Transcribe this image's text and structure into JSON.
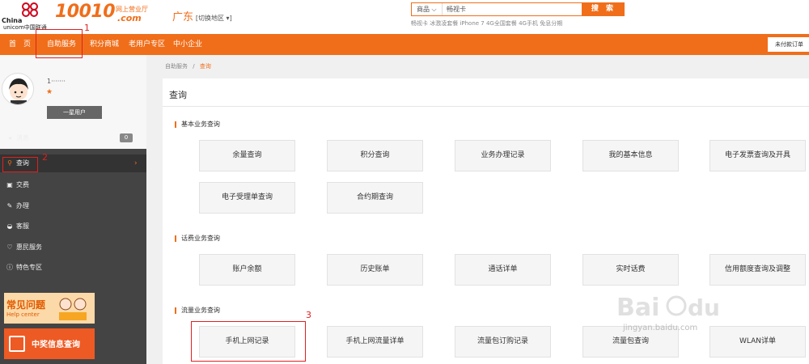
{
  "header": {
    "logo": {
      "en_line1": "China",
      "en_line2": "unicom中国联通"
    },
    "brand": {
      "number": "10010",
      "hall": "网上营业厅",
      "domain": ".com"
    },
    "region": {
      "province": "广东",
      "switch_label": "[切换地区 ▾]"
    },
    "search": {
      "category": "商品 ⌵",
      "value": "畅视卡",
      "button_label": "搜 索",
      "hot_words": "畅视卡  冰激凌套餐  iPhone 7  4G全国套餐  4G手机  免息分期"
    }
  },
  "nav": {
    "items": [
      "首　页",
      "自助服务",
      "积分商城",
      "老用户专区",
      "中小企业"
    ],
    "cart_label": "未付款订单"
  },
  "sidebar": {
    "username": "1·······",
    "star": "★",
    "level": "一星用户",
    "items": [
      {
        "icon": "speaker-icon",
        "glyph": "◂",
        "label": "消息",
        "count": "0"
      },
      {
        "icon": "search-icon",
        "glyph": "⚲",
        "label": "查询"
      },
      {
        "icon": "payment-icon",
        "glyph": "▣",
        "label": "交费"
      },
      {
        "icon": "pen-icon",
        "glyph": "✎",
        "label": "办理"
      },
      {
        "icon": "headset-icon",
        "glyph": "◒",
        "label": "客服"
      },
      {
        "icon": "heart-icon",
        "glyph": "♡",
        "label": "惠民服务"
      },
      {
        "icon": "info-icon",
        "glyph": "ⓘ",
        "label": "特色专区"
      }
    ],
    "banner_faq": {
      "title": "常见问题",
      "subtitle": "Help center"
    },
    "banner_prize": {
      "title": "中奖信息查询"
    }
  },
  "main": {
    "breadcrumb": {
      "parent": "自助服务",
      "separator": "/",
      "current": "查询"
    },
    "title": "查询",
    "sections": [
      {
        "title": "基本业务查询",
        "buttons": [
          "余量查询",
          "积分查询",
          "业务办理记录",
          "我的基本信息",
          "电子发票查询及开具",
          "电子受理单查询",
          "合约期查询"
        ]
      },
      {
        "title": "话费业务查询",
        "buttons": [
          "账户余额",
          "历史账单",
          "通话详单",
          "实时话费",
          "信用额度查询及调整"
        ]
      },
      {
        "title": "流量业务查询",
        "buttons": [
          "手机上网记录",
          "手机上网流量详单",
          "流量包订购记录",
          "流量包查询",
          "WLAN详单"
        ]
      }
    ]
  },
  "annotations": [
    "1",
    "2",
    "3"
  ],
  "watermark": {
    "text": "jingyan.baidu.com"
  },
  "colors": {
    "accent": "#f06e1a",
    "sidebar": "#444444",
    "annotation": "#e02020"
  }
}
